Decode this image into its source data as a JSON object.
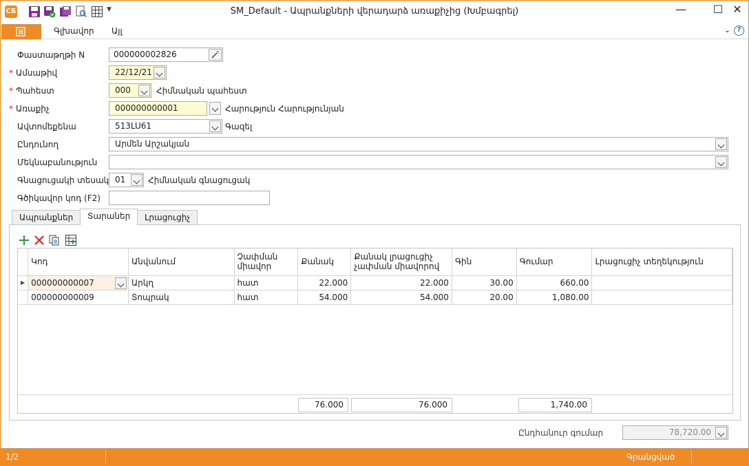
{
  "window": {
    "title": "SM_Default - Ապրանքների վերադարձ առաքիչից (Խմբագրել)",
    "app_icon_text": "CБ",
    "minimize": "—",
    "maximize": "☐",
    "close": "✕"
  },
  "ribbon": {
    "tabs": [
      "Գլխավոր",
      "Այլ"
    ],
    "help": "?"
  },
  "form": {
    "doc_number_label": "Փաստաթղթի N",
    "doc_number": "000000002826",
    "date_label": "Ամսաթիվ",
    "date": "22/12/21",
    "warehouse_label": "Պահեստ",
    "warehouse_code": "000",
    "warehouse_name": "Հիմնական պահեստ",
    "supplier_label": "Առաքիչ",
    "supplier_code": "000000000001",
    "supplier_name": "Հարություն Հարությունյան",
    "vehicle_label": "Ավտոմեքենա",
    "vehicle_code": "513LU61",
    "vehicle_name": "Գազել",
    "receiver_label": "Ընդունող",
    "receiver": "Արմեն Արշակյան",
    "comment_label": "Մեկնաբանություն",
    "comment": "",
    "price_type_label": "Գնացուցակի տեսակ",
    "price_type_code": "01",
    "price_type_name": "Հիմնական գնացուցակ",
    "barcode_label": "Գծիկավոր կոդ (F2)",
    "barcode": ""
  },
  "tabs": [
    "Ապրանքներ",
    "Տարաներ",
    "Լրացուցիչ"
  ],
  "active_tab": "Տարաներ",
  "table": {
    "headers": [
      "Կոդ",
      "Անվանում",
      "Չափման միավոր",
      "Քանակ",
      "Քանակ լրացուցիչ չափման միավորով",
      "Գին",
      "Գումար",
      "Լրացուցիչ տեղեկություն"
    ],
    "rows": [
      [
        "000000000007",
        "Արկղ",
        "հատ",
        "22.000",
        "22.000",
        "30.00",
        "660.00",
        ""
      ],
      [
        "000000000009",
        "Տոպրակ",
        "հատ",
        "54.000",
        "54.000",
        "20.00",
        "1,080.00",
        ""
      ]
    ],
    "totals": {
      "quantity": "76.000",
      "quantity_extra": "76.000",
      "amount": "1,740.00"
    }
  },
  "total": {
    "label": "Ընդհանուր գումար",
    "value": "78,720.00"
  },
  "status": {
    "page": "1/2",
    "state": "Գրանցված"
  },
  "colors": {
    "accent": "#f08a24",
    "required": "#e02020",
    "highlight": "#fdfbd2"
  }
}
